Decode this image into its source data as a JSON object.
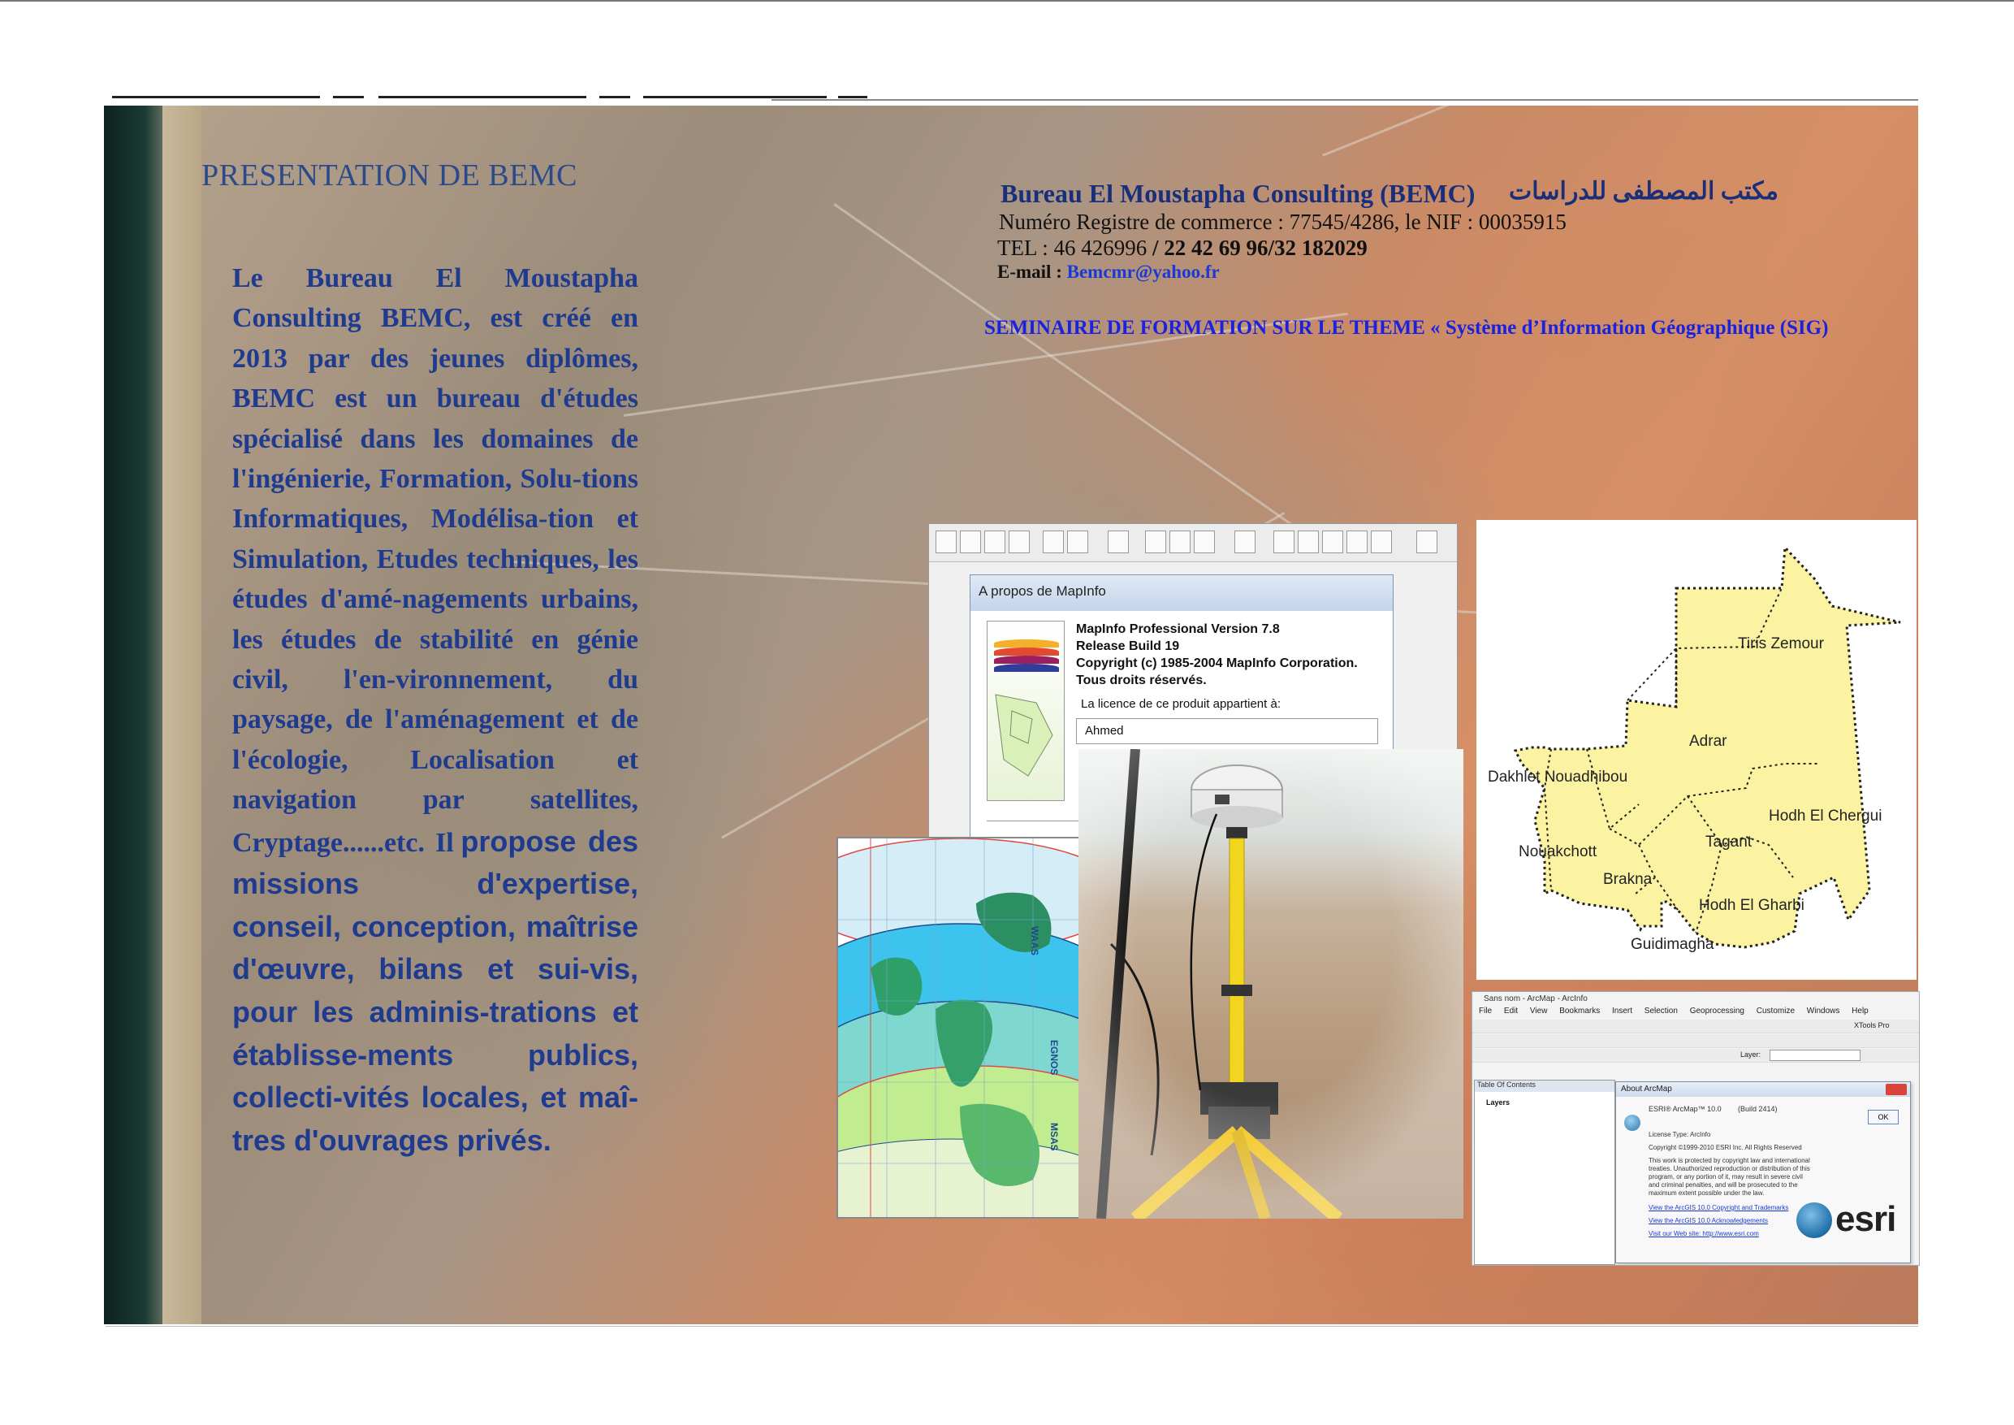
{
  "presentation": {
    "title": "PRESENTATION DE BEMC",
    "body_serif": "Le Bureau El Moustapha Consulting BEMC, est créé en 2013 par des jeunes diplômes, BEMC est un bureau d'études spécialisé dans les domaines de l'ingénierie, Formation, Solu-tions Informatiques, Modélisa-tion et Simulation, Etudes techniques, les études d'amé-nagements urbains, les études de stabilité en génie civil, l'en-vironnement, du paysage, de l'aménagement et de l'écologie, Localisation et navigation par satellites, Cryptage......etc. Il",
    "body_sans": "propose des missions d'expertise, conseil, conception, maîtrise d'œuvre, bilans et sui-vis, pour les adminis-trations et établisse-ments publics, collecti-vités locales, et maî-tres d'ouvrages privés."
  },
  "header": {
    "company_name": "Bureau El Moustapha Consulting (BEMC)",
    "arabic_name": "مكتب المصطفى للدراسات",
    "registration": "Numéro Registre de commerce : 77545/4286, le NIF : 00035915",
    "tel_label": "TEL : 46 426996 ",
    "tel_bold": "/ 22 42 69 96/32 182029",
    "email_label": "E-mail : ",
    "email": "Bemcmr@yahoo.fr",
    "seminar": "SEMINAIRE DE FORMATION SUR LE THEME « Système d’Information Géographique (SIG)"
  },
  "mapinfo": {
    "dialog_title": "A propos de MapInfo",
    "version": "MapInfo Professional Version 7.8",
    "release": "Release Build 19",
    "copyright": "Copyright (c) 1985-2004 MapInfo Corporation.",
    "rights": "Tous droits réservés.",
    "licence_label": "La licence de ce produit appartient à:",
    "licence_user": "Ahmed"
  },
  "world_map": {
    "labels": [
      "WAAS",
      "EGNOS",
      "MSAS"
    ]
  },
  "mauritania_map": {
    "regions": [
      "Tiris Zemour",
      "Adrar",
      "Dakhlet Nouadhibou",
      "Hodh El Chergui",
      "Nouakchott",
      "Tagant",
      "Brakna",
      "Hodh El Gharbi",
      "Guidimagha"
    ]
  },
  "arcmap": {
    "window_title": "Sans nom - ArcMap - ArcInfo",
    "menu": [
      "File",
      "Edit",
      "View",
      "Bookmarks",
      "Insert",
      "Selection",
      "Geoprocessing",
      "Customize",
      "Windows",
      "Help"
    ],
    "toolbar_label": "XTools Pro",
    "layer_label": "Layer:",
    "toc_title": "Table Of Contents",
    "toc_layers": "Layers",
    "about_title": "About ArcMap",
    "product": "ESRI® ArcMap™ 10.0",
    "build": "(Build 2414)",
    "license_type": "License Type:  ArcInfo",
    "copyright": "Copyright ©1999-2010 ESRI Inc. All Rights Reserved",
    "legal": "This work is protected by copyright law and international treaties. Unauthorized reproduction or distribution of this program, or any portion of it, may result in severe civil and criminal penalties, and will be prosecuted to the maximum extent possible under the law.",
    "link1": "View the ArcGIS 10.0 Copyright and Trademarks",
    "link2": "View the ArcGIS 10.0 Acknowledgements",
    "link3": "Visit our Web site:  http://www.esri.com",
    "ok": "OK",
    "logo": "esri"
  }
}
